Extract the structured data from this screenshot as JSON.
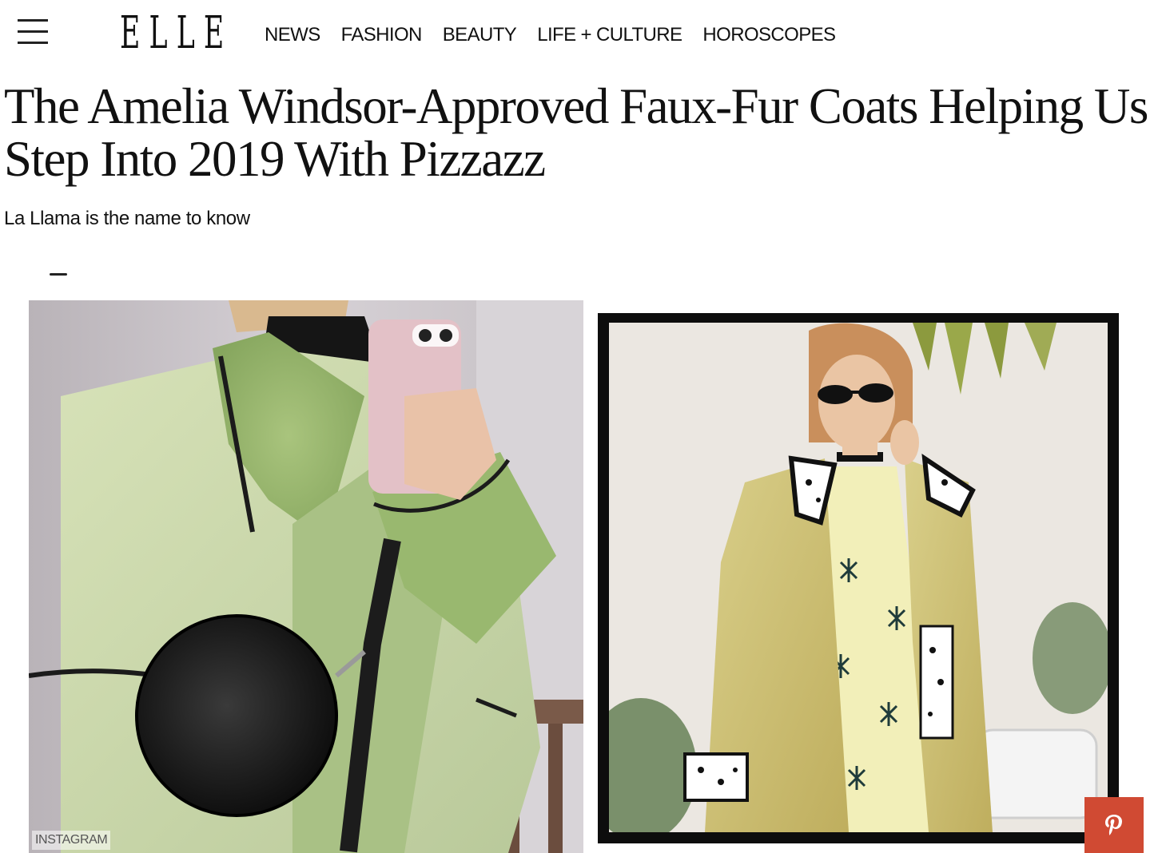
{
  "header": {
    "logo": "ELLE",
    "nav": [
      "NEWS",
      "FASHION",
      "BEAUTY",
      "LIFE + CULTURE",
      "HOROSCOPES"
    ]
  },
  "article": {
    "title": "The Amelia Windsor-Approved Faux-Fur Coats Helping Us Step Into 2019 With Pizzazz",
    "dek": "La Llama is the name to know"
  },
  "images": {
    "left_credit": "INSTAGRAM"
  },
  "icons": {
    "menu": "hamburger-icon",
    "pinterest": "pinterest-icon"
  },
  "colors": {
    "pinterest": "#d04a33",
    "text": "#111111"
  }
}
